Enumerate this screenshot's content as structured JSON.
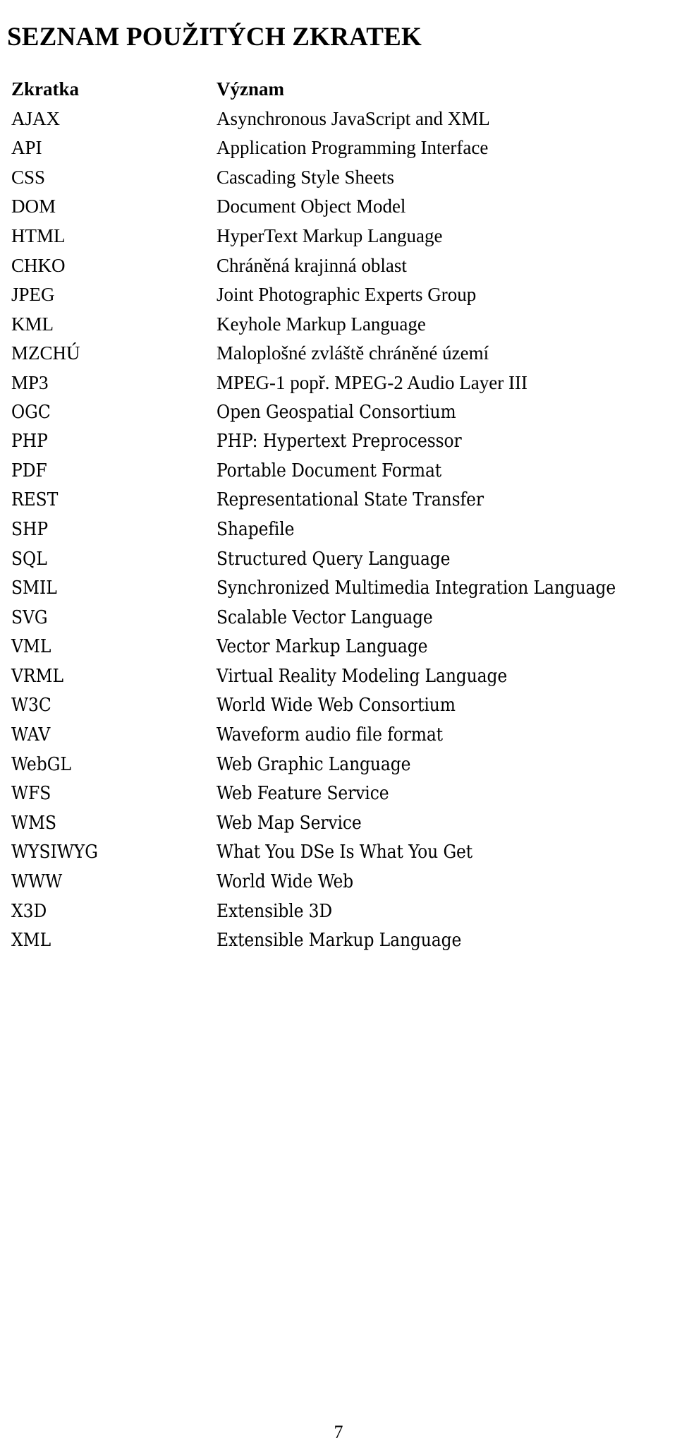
{
  "document": {
    "title": "SEZNAM POUŽITÝCH ZKRATEK",
    "page_number": "7"
  },
  "table": {
    "headers": {
      "abbreviation": "Zkratka",
      "meaning": "Význam"
    },
    "rows": [
      {
        "abbr": "AJAX",
        "meaning": "Asynchronous JavaScript and XML"
      },
      {
        "abbr": "API",
        "meaning": "Application Programming Interface"
      },
      {
        "abbr": "CSS",
        "meaning": "Cascading Style Sheets"
      },
      {
        "abbr": "DOM",
        "meaning": "Document Object Model"
      },
      {
        "abbr": "HTML",
        "meaning": "HyperText Markup Language"
      },
      {
        "abbr": "CHKO",
        "meaning": "Chráněná krajinná oblast"
      },
      {
        "abbr": "JPEG",
        "meaning": "Joint Photographic Experts Group"
      },
      {
        "abbr": "KML",
        "meaning": "Keyhole Markup Language"
      },
      {
        "abbr": "MZCHÚ",
        "meaning": "Maloplošné zvláště chráněné území"
      },
      {
        "abbr": "MP3",
        "meaning": "MPEG-1 popř. MPEG-2 Audio Layer III"
      },
      {
        "abbr": "OGC",
        "meaning": "Open Geospatial Consortium"
      },
      {
        "abbr": "PHP",
        "meaning": "PHP: Hypertext Preprocessor"
      },
      {
        "abbr": "PDF",
        "meaning": "Portable Document Format"
      },
      {
        "abbr": "REST",
        "meaning": "Representational State Transfer"
      },
      {
        "abbr": "SHP",
        "meaning": "Shapefile"
      },
      {
        "abbr": "SQL",
        "meaning": "Structured Query Language"
      },
      {
        "abbr": "SMIL",
        "meaning": "Synchronized Multimedia Integration Language"
      },
      {
        "abbr": "SVG",
        "meaning": "Scalable Vector Language"
      },
      {
        "abbr": "VML",
        "meaning": "Vector Markup Language"
      },
      {
        "abbr": "VRML",
        "meaning": "Virtual Reality Modeling Language"
      },
      {
        "abbr": "W3C",
        "meaning": "World Wide Web Consortium"
      },
      {
        "abbr": "WAV",
        "meaning": "Waveform audio file format"
      },
      {
        "abbr": "WebGL",
        "meaning": "Web Graphic Language"
      },
      {
        "abbr": "WFS",
        "meaning": "Web Feature Service"
      },
      {
        "abbr": "WMS",
        "meaning": "Web Map Service"
      },
      {
        "abbr": "WYSIWYG",
        "meaning": "What You DSe Is What You Get"
      },
      {
        "abbr": "WWW",
        "meaning": "World Wide Web"
      },
      {
        "abbr": "X3D",
        "meaning": "Extensible 3D"
      },
      {
        "abbr": "XML",
        "meaning": "Extensible Markup Language"
      }
    ]
  },
  "style": {
    "text_color": "#000000",
    "background_color": "#ffffff"
  }
}
